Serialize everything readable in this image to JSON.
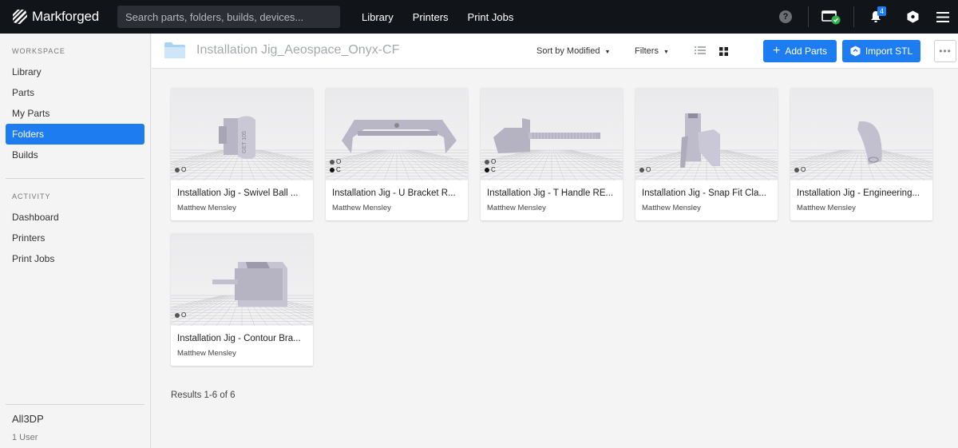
{
  "brand": {
    "name": "Markforged",
    "accent": "#1c7cf0",
    "topbar_bg": "#111418"
  },
  "search": {
    "placeholder": "Search parts, folders, builds, devices..."
  },
  "top_nav": [
    "Library",
    "Printers",
    "Print Jobs"
  ],
  "top_icons": {
    "help": "?",
    "notifications_count": "4"
  },
  "sidebar": {
    "workspace_heading": "WORKSPACE",
    "workspace_items": [
      {
        "label": "Library",
        "active": false
      },
      {
        "label": "Parts",
        "active": false
      },
      {
        "label": "My Parts",
        "active": false
      },
      {
        "label": "Folders",
        "active": true
      },
      {
        "label": "Builds",
        "active": false
      }
    ],
    "activity_heading": "ACTIVITY",
    "activity_items": [
      {
        "label": "Dashboard"
      },
      {
        "label": "Printers"
      },
      {
        "label": "Print Jobs"
      }
    ],
    "org_name": "All3DP",
    "user_count": "1 User"
  },
  "header": {
    "folder_title": "Installation Jig_Aeospace_Onyx-CF",
    "sort_label": "Sort by Modified",
    "filters_label": "Filters",
    "add_parts_label": "Add Parts",
    "import_stl_label": "Import STL",
    "more_label": "•••"
  },
  "parts": [
    {
      "title": "Installation Jig - Swivel Ball ...",
      "author": "Matthew Mensley",
      "materials": [
        "O"
      ],
      "engraving": "GET 105"
    },
    {
      "title": "Installation Jig - U Bracket R...",
      "author": "Matthew Mensley",
      "materials": [
        "O",
        "C"
      ]
    },
    {
      "title": "Installation Jig - T Handle RE...",
      "author": "Matthew Mensley",
      "materials": [
        "O",
        "C"
      ]
    },
    {
      "title": "Installation Jig - Snap Fit Cla...",
      "author": "Matthew Mensley",
      "materials": [
        "O"
      ]
    },
    {
      "title": "Installation Jig - Engineering...",
      "author": "Matthew Mensley",
      "materials": [
        "O"
      ]
    },
    {
      "title": "Installation Jig - Contour Bra...",
      "author": "Matthew Mensley",
      "materials": [
        "O"
      ]
    }
  ],
  "results_text": "Results 1-6 of 6"
}
